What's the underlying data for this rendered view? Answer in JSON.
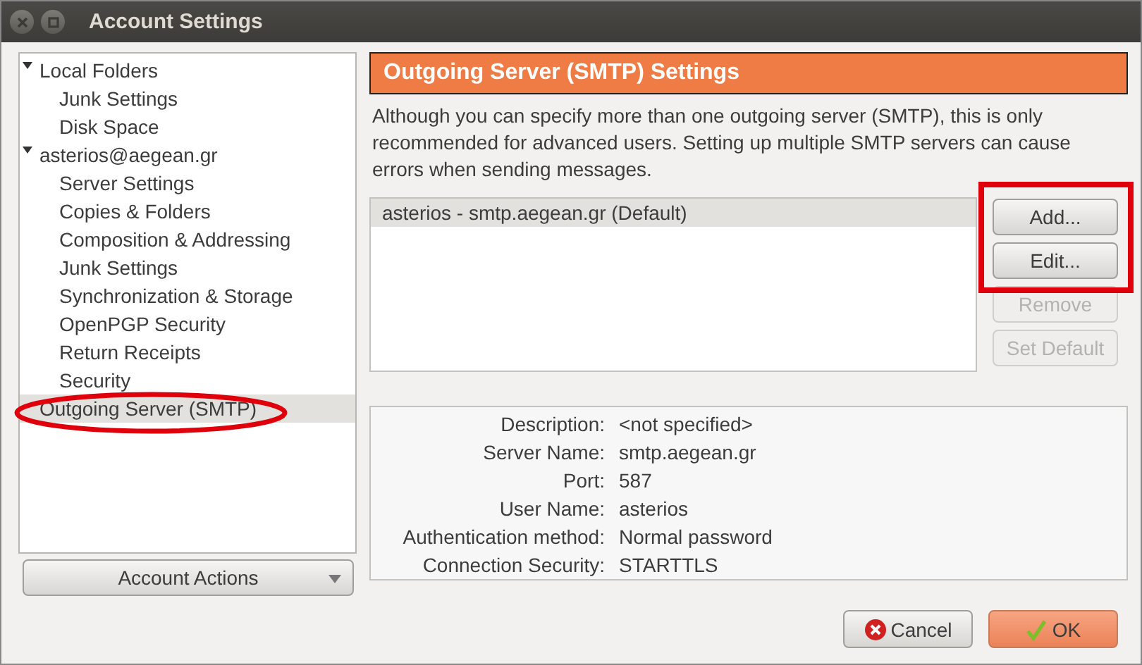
{
  "window": {
    "title": "Account Settings",
    "controls": [
      {
        "kind": "close"
      },
      {
        "kind": "maximize"
      }
    ]
  },
  "sidebar": {
    "items": [
      {
        "label": "Local Folders",
        "expanded": true,
        "selected": false,
        "children": [
          {
            "label": "Junk Settings",
            "selected": false
          },
          {
            "label": "Disk Space",
            "selected": false
          }
        ]
      },
      {
        "label": "asterios@aegean.gr",
        "expanded": true,
        "selected": false,
        "children": [
          {
            "label": "Server Settings",
            "selected": false
          },
          {
            "label": "Copies & Folders",
            "selected": false
          },
          {
            "label": "Composition & Addressing",
            "selected": false
          },
          {
            "label": "Junk Settings",
            "selected": false
          },
          {
            "label": "Synchronization & Storage",
            "selected": false
          },
          {
            "label": "OpenPGP Security",
            "selected": false
          },
          {
            "label": "Return Receipts",
            "selected": false
          },
          {
            "label": "Security",
            "selected": false
          }
        ]
      },
      {
        "label": "Outgoing Server (SMTP)",
        "selected": true
      }
    ],
    "account_actions": "Account Actions"
  },
  "panel": {
    "title": "Outgoing Server (SMTP) Settings",
    "description": "Although you can specify more than one outgoing server (SMTP), this is only recommended for advanced users. Setting up multiple SMTP servers can cause errors when sending messages.",
    "servers": [
      {
        "label": "asterios - smtp.aegean.gr (Default)",
        "selected": true
      }
    ],
    "buttons": [
      {
        "label": "Add...",
        "disabled": false
      },
      {
        "label": "Edit...",
        "disabled": false
      },
      {
        "label": "Remove",
        "disabled": true
      },
      {
        "label": "Set Default",
        "disabled": true
      }
    ],
    "details": [
      {
        "label": "Description:",
        "value": "<not specified>"
      },
      {
        "label": "Server Name:",
        "value": "smtp.aegean.gr"
      },
      {
        "label": "Port:",
        "value": "587"
      },
      {
        "label": "User Name:",
        "value": "asterios"
      },
      {
        "label": "Authentication method:",
        "value": "Normal password"
      },
      {
        "label": "Connection Security:",
        "value": "STARTTLS"
      }
    ]
  },
  "dialog_buttons": [
    {
      "label": "Cancel",
      "kind": "cancel"
    },
    {
      "label": "OK",
      "kind": "ok"
    }
  ],
  "annotations": [
    {
      "kind": "ellipse",
      "color": "#e0000b"
    },
    {
      "kind": "rectangle",
      "color": "#e0000b"
    }
  ]
}
